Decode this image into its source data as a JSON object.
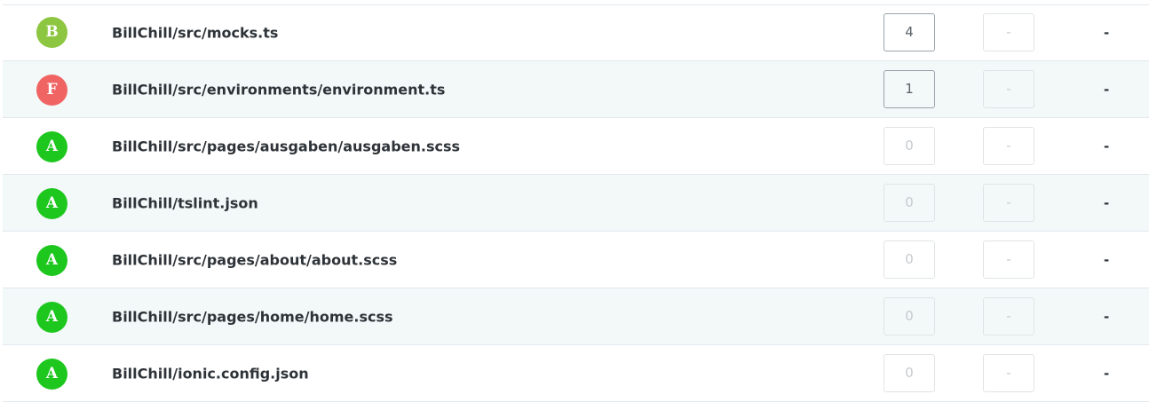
{
  "colors": {
    "grade_A": "#1ec71e",
    "grade_B": "#8dc640",
    "grade_F": "#f06464",
    "row_alt_bg": "#f3f8f8",
    "row_border": "#e3e8ee"
  },
  "files": [
    {
      "grade": "B",
      "path": "BillChill/src/mocks.ts",
      "issues": "4",
      "duplication": "-",
      "extra": "-",
      "issues_active": true
    },
    {
      "grade": "F",
      "path": "BillChill/src/environments/environment.ts",
      "issues": "1",
      "duplication": "-",
      "extra": "-",
      "issues_active": true
    },
    {
      "grade": "A",
      "path": "BillChill/src/pages/ausgaben/ausgaben.scss",
      "issues": "0",
      "duplication": "-",
      "extra": "-",
      "issues_active": false
    },
    {
      "grade": "A",
      "path": "BillChill/tslint.json",
      "issues": "0",
      "duplication": "-",
      "extra": "-",
      "issues_active": false
    },
    {
      "grade": "A",
      "path": "BillChill/src/pages/about/about.scss",
      "issues": "0",
      "duplication": "-",
      "extra": "-",
      "issues_active": false
    },
    {
      "grade": "A",
      "path": "BillChill/src/pages/home/home.scss",
      "issues": "0",
      "duplication": "-",
      "extra": "-",
      "issues_active": false
    },
    {
      "grade": "A",
      "path": "BillChill/ionic.config.json",
      "issues": "0",
      "duplication": "-",
      "extra": "-",
      "issues_active": false
    }
  ]
}
